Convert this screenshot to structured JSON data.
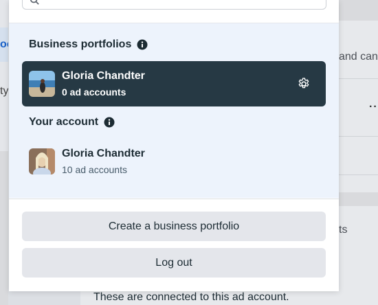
{
  "background": {
    "left_link_fragment": "oo",
    "left_text_fragment": "ty",
    "right_text_fragment": "and can",
    "right_more_dots": "··",
    "right_text_fragment2": "ts",
    "bottom_text": "These are connected to this ad account."
  },
  "dropdown": {
    "search": {
      "placeholder": ""
    },
    "business_portfolios": {
      "title": "Business portfolios",
      "items": [
        {
          "name": "Gloria Chandter",
          "subtitle": "0 ad accounts",
          "selected": true
        }
      ]
    },
    "your_account": {
      "title": "Your account",
      "items": [
        {
          "name": "Gloria Chandter",
          "subtitle": "10 ad accounts"
        }
      ]
    },
    "buttons": {
      "create_portfolio": "Create a business portfolio",
      "log_out": "Log out"
    }
  },
  "colors": {
    "selected_bg": "#263944",
    "list_bg": "#edf3fc",
    "button_bg": "#e4e6eb"
  }
}
